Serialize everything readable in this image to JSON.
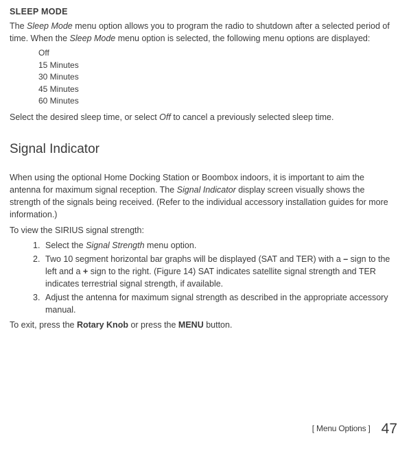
{
  "sleep_mode": {
    "title": "SLEEP MODE",
    "p1_a": "The ",
    "p1_i1": "Sleep Mode",
    "p1_b": " menu option allows you to program the radio to shutdown after a selected period of time. When the ",
    "p1_i2": "Sleep Mode",
    "p1_c": " menu option is selected, the following menu options are displayed:",
    "options": {
      "o1": "Off",
      "o2": "15 Minutes",
      "o3": "30 Minutes",
      "o4": "45 Minutes",
      "o5": "60 Minutes"
    },
    "p2_a": "Select the desired sleep time, or select ",
    "p2_i": "Off",
    "p2_b": " to cancel a previously selected sleep time."
  },
  "signal": {
    "heading": "Signal Indicator",
    "p1_a": "When using the optional Home Docking Station or Boombox indoors, it is important to aim the antenna for maximum signal reception. The ",
    "p1_i": "Signal Indicator",
    "p1_b": " display screen visually shows the strength of the signals being received. (Refer to the individual accessory installation guides for more information.)",
    "p2": "To view the SIRIUS signal strength:",
    "list": {
      "n1": "1.",
      "n2": "2.",
      "n3": "3.",
      "i1_a": "Select the ",
      "i1_i": "Signal Strength",
      "i1_b": " menu option.",
      "i2_a": "Two 10 segment horizontal bar graphs will be displayed (SAT and TER) with a ",
      "i2_b1": "–",
      "i2_b": " sign to the left and a ",
      "i2_b2": "+",
      "i2_c": " sign to the right. (Figure 14) SAT indicates satellite signal strength and TER indicates terrestrial signal strength, if available.",
      "i3": "Adjust the antenna for maximum signal strength as described in the appropriate accessory manual."
    },
    "p3_a": "To exit, press the ",
    "p3_b1": "Rotary Knob",
    "p3_b": " or press the ",
    "p3_b2": "MENU",
    "p3_c": " button."
  },
  "footer": {
    "bracket_open": "[",
    "label": " Menu Options ",
    "bracket_close": "]",
    "page": "47"
  }
}
